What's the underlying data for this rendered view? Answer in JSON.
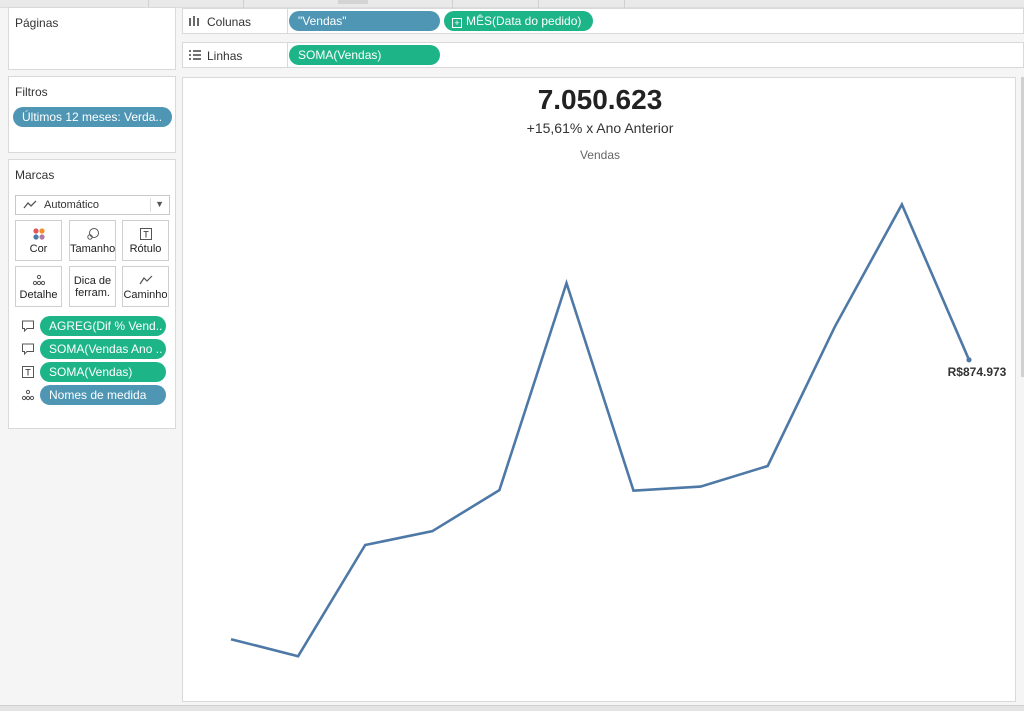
{
  "pages_panel": {
    "title": "Páginas"
  },
  "filters_panel": {
    "title": "Filtros",
    "filters": [
      {
        "label": "Últimos 12 meses: Verda.."
      }
    ]
  },
  "marks_panel": {
    "title": "Marcas",
    "mark_type": "Automático",
    "buttons": {
      "cor": "Cor",
      "tamanho": "Tamanho",
      "rotulo": "Rótulo",
      "detalhe": "Detalhe",
      "dica": "Dica de ferram.",
      "caminho": "Caminho"
    },
    "fields": [
      {
        "label": "AGREG(Dif % Vend..",
        "role": "tooltip",
        "color": "#1db588"
      },
      {
        "label": "SOMA(Vendas Ano ..",
        "role": "tooltip",
        "color": "#1db588"
      },
      {
        "label": "SOMA(Vendas)",
        "role": "label",
        "color": "#1db588"
      },
      {
        "label": "Nomes de medida",
        "role": "detail",
        "color": "#4e96b4"
      }
    ]
  },
  "shelves": {
    "columns": {
      "label": "Colunas",
      "pills": [
        {
          "label": "\"Vendas\""
        },
        {
          "label": "MÊS(Data do pedido)"
        }
      ]
    },
    "rows": {
      "label": "Linhas",
      "pills": [
        {
          "label": "SOMA(Vendas)"
        }
      ]
    }
  },
  "view": {
    "kpi_value": "7.050.623",
    "kpi_subtitle": "+15,61% x Ano Anterior",
    "measure_title": "Vendas"
  },
  "chart_data": {
    "type": "line",
    "title": "Vendas",
    "x": [
      1,
      2,
      3,
      4,
      5,
      6,
      7,
      8,
      9,
      10,
      11,
      12
    ],
    "series": [
      {
        "values": [
          249000,
          211000,
          460000,
          491000,
          583000,
          1047000,
          582000,
          591000,
          637000,
          949000,
          1223000,
          874973
        ],
        "color": "#4e79a7",
        "end_label": "R$874.973"
      }
    ],
    "ylim": [
      180000,
      1260000
    ],
    "grid": false,
    "axes_visible": false
  }
}
